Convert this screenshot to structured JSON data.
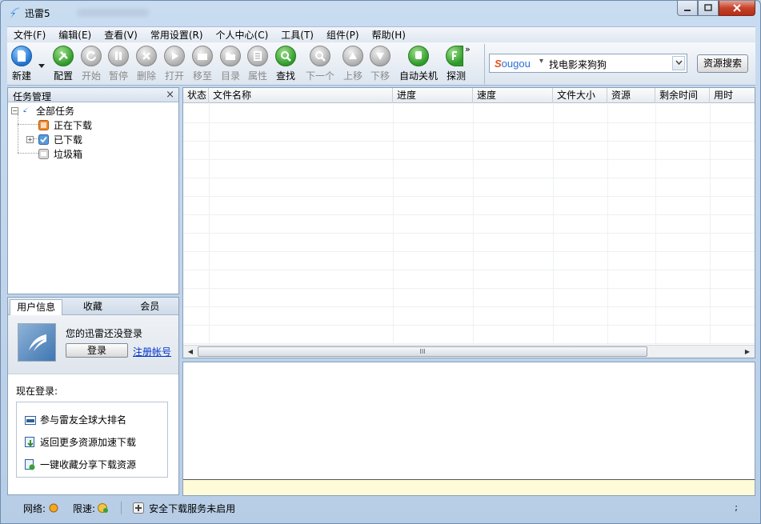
{
  "window": {
    "title": "迅雷5"
  },
  "menu": [
    {
      "label": "文件(F)"
    },
    {
      "label": "编辑(E)"
    },
    {
      "label": "查看(V)"
    },
    {
      "label": "常用设置(R)"
    },
    {
      "label": "个人中心(C)"
    },
    {
      "label": "工具(T)"
    },
    {
      "label": "组件(P)"
    },
    {
      "label": "帮助(H)"
    }
  ],
  "toolbar": {
    "new": "新建",
    "config": "配置",
    "start": "开始",
    "pause": "暂停",
    "delete": "删除",
    "open": "打开",
    "move": "移至",
    "dir": "目录",
    "props": "属性",
    "find": "查找",
    "next": "下一个",
    "up": "上移",
    "down": "下移",
    "autoshutdown": "自动关机",
    "detect": "探测",
    "more": "»"
  },
  "search": {
    "brand": "Sougou",
    "value": "找电影来狗狗",
    "button": "资源搜索"
  },
  "task_panel": {
    "title": "任务管理",
    "close": "×",
    "tree": {
      "root": "全部任务",
      "downloading": "正在下载",
      "downloaded": "已下载",
      "trash": "垃圾箱",
      "expand_minus": "−",
      "expand_plus": "+"
    }
  },
  "user_panel": {
    "tabs": [
      "用户信息",
      "收藏",
      "会员"
    ],
    "login_message": "您的迅雷还没登录",
    "login_button": "登录",
    "register_link": "注册帐号",
    "now_login": "现在登录:",
    "features": [
      "参与雷友全球大排名",
      "返回更多资源加速下载",
      "一键收藏分享下载资源"
    ]
  },
  "task_list": {
    "columns": [
      "状态",
      "文件名称",
      "进度",
      "速度",
      "文件大小",
      "资源",
      "剩余时间",
      "用时"
    ],
    "rows": [],
    "scroll_grip": "III",
    "scroll_left": "◀",
    "scroll_right": "▶"
  },
  "statusbar": {
    "network_label": "网络:",
    "limit_label": "限速:",
    "security_text": "安全下载服务未启用",
    "right_mark": ";"
  },
  "colors": {
    "accent": "#1f72d0",
    "toolbar_green": "#2f9a2a",
    "close_button": "#c5432b",
    "detail_strip": "#fffbd8"
  }
}
